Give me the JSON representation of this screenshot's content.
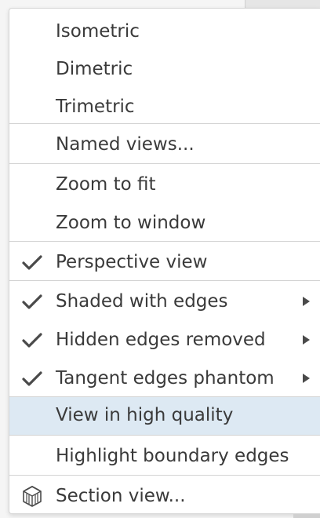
{
  "menu": {
    "items": [
      {
        "label": "Isometric",
        "checked": false,
        "submenu": false
      },
      {
        "label": "Dimetric",
        "checked": false,
        "submenu": false
      },
      {
        "label": "Trimetric",
        "checked": false,
        "submenu": false
      },
      {
        "label": "Named views...",
        "checked": false,
        "submenu": false
      },
      {
        "label": "Zoom to fit",
        "checked": false,
        "submenu": false
      },
      {
        "label": "Zoom to window",
        "checked": false,
        "submenu": false
      },
      {
        "label": "Perspective view",
        "checked": true,
        "submenu": false
      },
      {
        "label": "Shaded with edges",
        "checked": true,
        "submenu": true
      },
      {
        "label": "Hidden edges removed",
        "checked": true,
        "submenu": true
      },
      {
        "label": "Tangent edges phantom",
        "checked": true,
        "submenu": true
      },
      {
        "label": "View in high quality",
        "checked": false,
        "submenu": false,
        "highlighted": true
      },
      {
        "label": "Highlight boundary edges",
        "checked": false,
        "submenu": false
      },
      {
        "label": "Section view...",
        "checked": false,
        "submenu": false,
        "icon": "section-view-icon"
      }
    ]
  },
  "colors": {
    "highlight": "#dde9f3",
    "text": "#3a3a3a",
    "divider": "#d3d3d3"
  }
}
